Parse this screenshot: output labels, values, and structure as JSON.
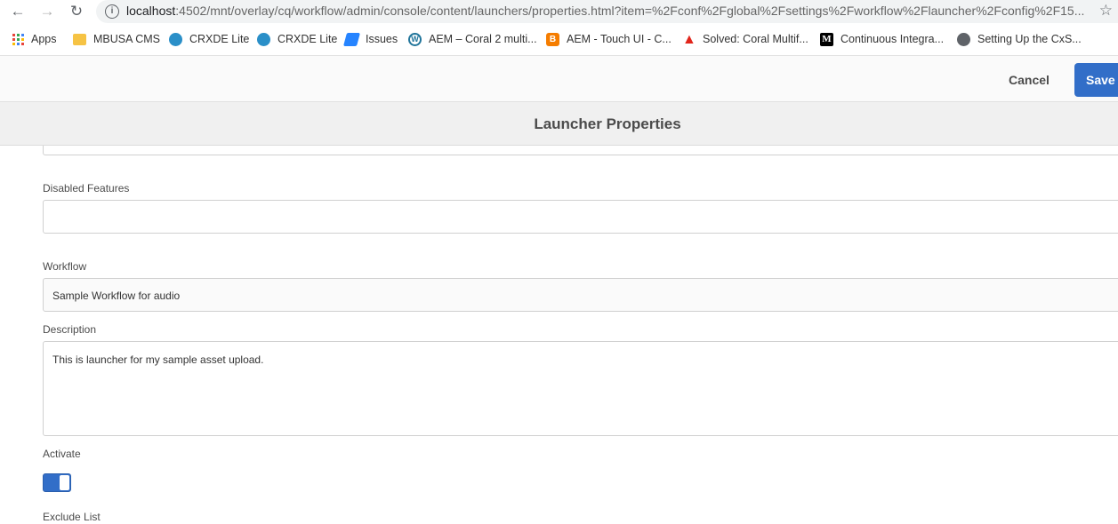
{
  "browser": {
    "url_host": "localhost",
    "url_rest": ":4502/mnt/overlay/cq/workflow/admin/console/content/launchers/properties.html?item=%2Fconf%2Fglobal%2Fsettings%2Fworkflow%2Flauncher%2Fconfig%2F15...",
    "bookmarks": [
      {
        "label": "Apps",
        "icon": "apps-grid-icon"
      },
      {
        "label": "MBUSA CMS",
        "icon": "folder-icon",
        "color": "#f6c344"
      },
      {
        "label": "CRXDE Lite",
        "icon": "crxde-icon",
        "color": "#2a8fc8"
      },
      {
        "label": "CRXDE Lite",
        "icon": "crxde-icon",
        "color": "#2a8fc8"
      },
      {
        "label": "Issues",
        "icon": "jira-icon",
        "color": "#2684ff"
      },
      {
        "label": "AEM – Coral 2 multi...",
        "icon": "wordpress-icon",
        "color": "#21759b"
      },
      {
        "label": "AEM - Touch UI - C...",
        "icon": "blogger-icon",
        "color": "#f57d00"
      },
      {
        "label": "Solved: Coral Multif...",
        "icon": "adobe-icon",
        "color": "#e1251b"
      },
      {
        "label": "Continuous Integra...",
        "icon": "medium-icon",
        "color": "#000000"
      },
      {
        "label": "Setting Up the CxS...",
        "icon": "globe-icon",
        "color": "#5f6368"
      }
    ]
  },
  "appbar": {
    "cancel_label": "Cancel",
    "save_label": "Save &"
  },
  "title": "Launcher Properties",
  "form": {
    "disabled_features_label": "Disabled Features",
    "disabled_features_value": "",
    "workflow_label": "Workflow",
    "workflow_value": "Sample Workflow for audio",
    "description_label": "Description",
    "description_value": "This is launcher for my sample asset upload.",
    "activate_label": "Activate",
    "activate_on": true,
    "exclude_list_label": "Exclude List"
  },
  "colors": {
    "accent": "#326ec8"
  }
}
